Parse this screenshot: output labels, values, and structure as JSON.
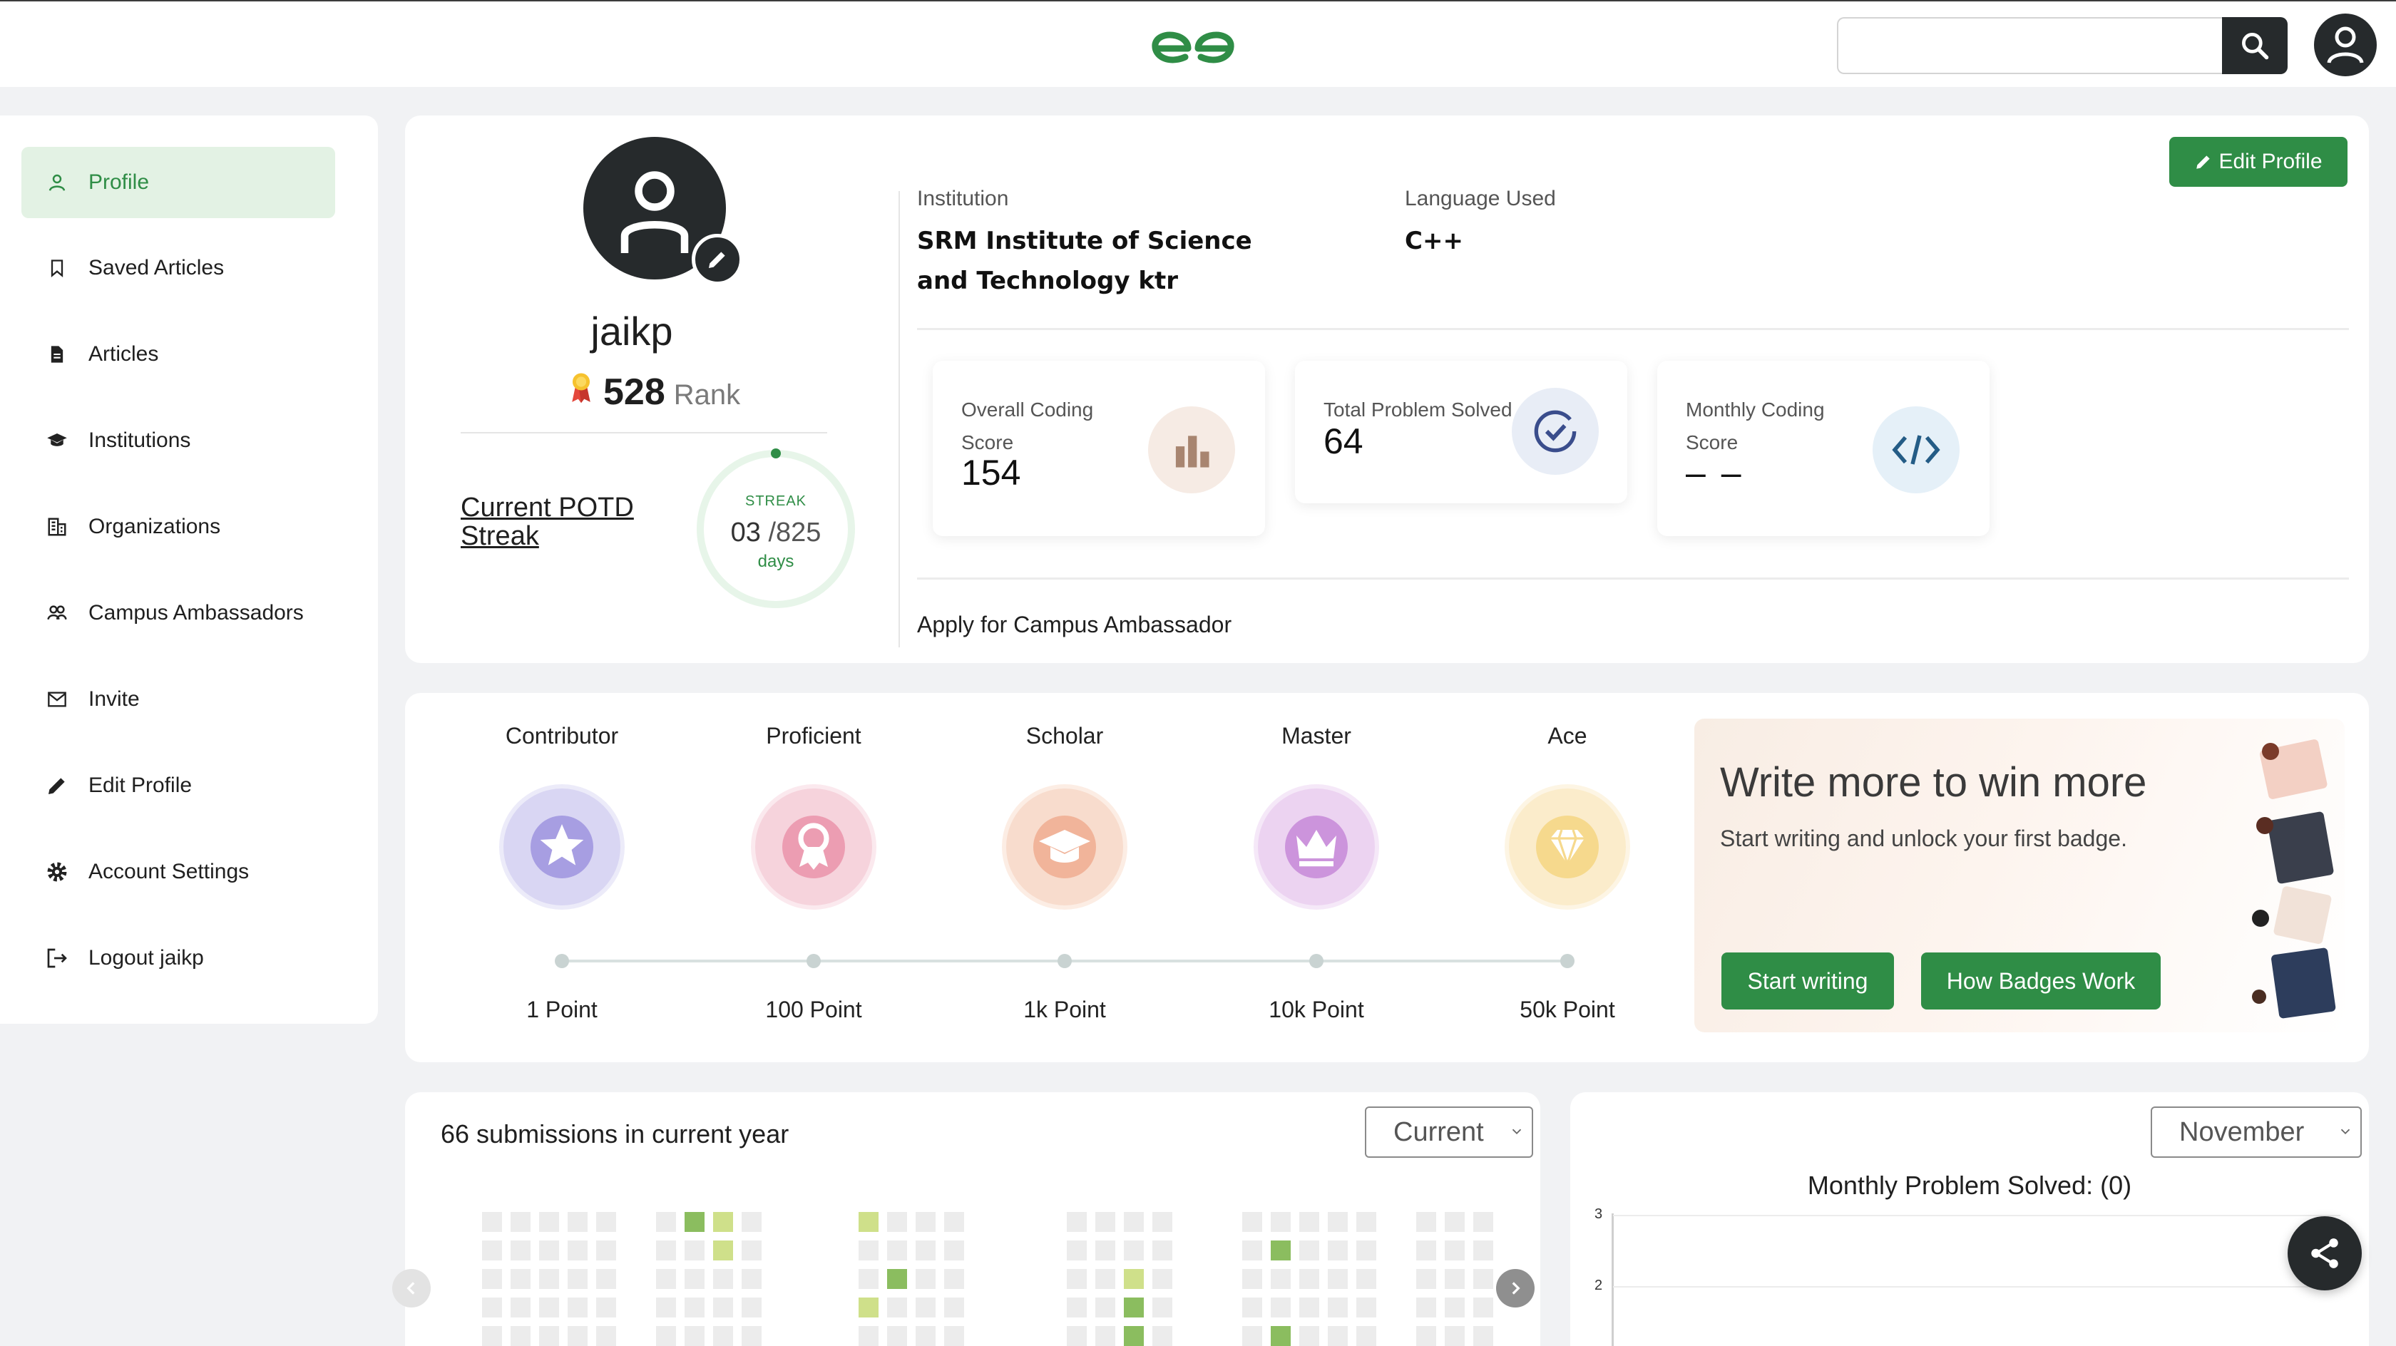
{
  "header": {
    "search_placeholder": ""
  },
  "sidebar": {
    "items": [
      {
        "label": "Profile",
        "icon": "user-icon",
        "active": true
      },
      {
        "label": "Saved Articles",
        "icon": "bookmark-icon"
      },
      {
        "label": "Articles",
        "icon": "document-icon"
      },
      {
        "label": "Institutions",
        "icon": "graduation-cap-icon"
      },
      {
        "label": "Organizations",
        "icon": "building-icon"
      },
      {
        "label": "Campus Ambassadors",
        "icon": "users-icon"
      },
      {
        "label": "Invite",
        "icon": "mail-icon"
      },
      {
        "label": "Edit Profile",
        "icon": "pencil-icon"
      },
      {
        "label": "Account Settings",
        "icon": "gear-icon"
      },
      {
        "label": "Logout jaikp",
        "icon": "logout-icon"
      }
    ]
  },
  "profile": {
    "username": "jaikp",
    "rank_number": "528",
    "rank_label": "Rank",
    "potd_link": "Current POTD Streak",
    "streak_label": "STREAK",
    "streak_current": "03",
    "streak_total": "/825",
    "streak_unit": "days",
    "institution_label": "Institution",
    "institution_value": "SRM Institute of Science and Technology ktr",
    "language_label": "Language Used",
    "language_value": "C++",
    "edit_button": "Edit Profile",
    "apply_link": "Apply for Campus Ambassador"
  },
  "stats": [
    {
      "title": "Overall Coding Score",
      "value": "154",
      "icon": "bar-chart-icon"
    },
    {
      "title": "Total Problem Solved",
      "value": "64",
      "icon": "check-circle-icon"
    },
    {
      "title": "Monthly Coding Score",
      "value": "– –",
      "icon": "code-icon"
    }
  ],
  "badges": [
    {
      "name": "Contributor",
      "points": "1 Point",
      "icon": "star-icon"
    },
    {
      "name": "Proficient",
      "points": "100 Point",
      "icon": "ribbon-icon"
    },
    {
      "name": "Scholar",
      "points": "1k Point",
      "icon": "mortarboard-icon"
    },
    {
      "name": "Master",
      "points": "10k Point",
      "icon": "crown-icon"
    },
    {
      "name": "Ace",
      "points": "50k Point",
      "icon": "diamond-icon"
    }
  ],
  "promo": {
    "title": "Write more to win more",
    "subtitle": "Start writing and unlock your first badge.",
    "start_button": "Start writing",
    "how_button": "How Badges Work"
  },
  "submissions": {
    "title": "66 submissions in current year",
    "year_select": "Current"
  },
  "monthly": {
    "month_select": "November",
    "chart_title": "Monthly Problem Solved: (0)",
    "y_ticks": [
      "3",
      "2"
    ]
  },
  "colors": {
    "brand_green": "#2f8d46",
    "dark": "#262a2c"
  }
}
